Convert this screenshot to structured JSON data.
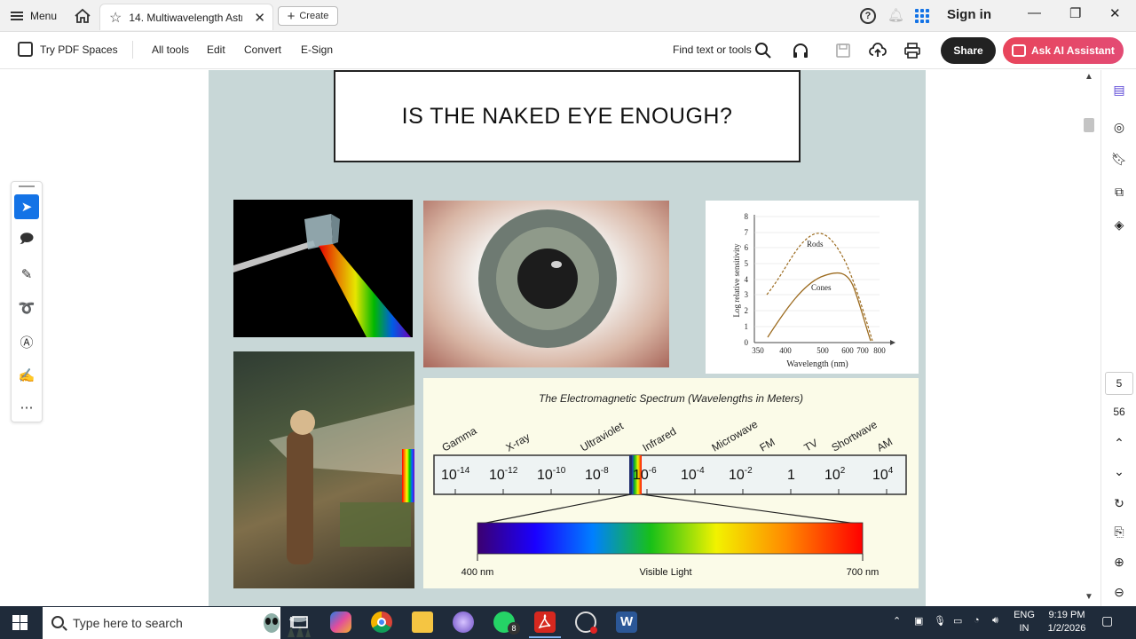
{
  "titlebar": {
    "menu_label": "Menu",
    "tab_title": "14. Multiwavelength Astr...",
    "create_label": "Create",
    "sign_in": "Sign in"
  },
  "toolbar": {
    "spaces_label": "Try PDF Spaces",
    "menu_items": [
      "All tools",
      "Edit",
      "Convert",
      "E-Sign"
    ],
    "find_label": "Find text or tools",
    "share_label": "Share",
    "ai_label": "Ask AI Assistant"
  },
  "slide": {
    "title": "IS THE NAKED EYE ENOUGH?",
    "sensitivity": {
      "ylabel": "Log relative sensitivity",
      "xlabel": "Wavelength (nm)",
      "yticks": [
        "0",
        "1",
        "2",
        "3",
        "4",
        "5",
        "6",
        "7",
        "8"
      ],
      "xticks": [
        "350",
        "400",
        "500",
        "600",
        "700",
        "800"
      ],
      "rods_label": "Rods",
      "cones_label": "Cones"
    },
    "em": {
      "title": "The Electromagnetic Spectrum (Wavelengths in Meters)",
      "bands": [
        "Gamma",
        "X-ray",
        "Ultraviolet",
        "Infrared",
        "Microwave",
        "FM",
        "TV",
        "Shortwave",
        "AM"
      ],
      "ticks": [
        {
          "base": "10",
          "exp": "-14"
        },
        {
          "base": "10",
          "exp": "-12"
        },
        {
          "base": "10",
          "exp": "-10"
        },
        {
          "base": "10",
          "exp": "-8"
        },
        {
          "base": "10",
          "exp": "-6"
        },
        {
          "base": "10",
          "exp": "-4"
        },
        {
          "base": "10",
          "exp": "-2"
        },
        {
          "base": "1",
          "exp": ""
        },
        {
          "base": "10",
          "exp": "2"
        },
        {
          "base": "10",
          "exp": "4"
        }
      ],
      "visible_start": "400 nm",
      "visible_label": "Visible Light",
      "visible_end": "700 nm"
    }
  },
  "sidebar": {
    "current_page": "5",
    "total_pages": "56"
  },
  "taskbar": {
    "search_placeholder": "Type here to search",
    "whatsapp_badge": "8",
    "lang_top": "ENG",
    "lang_bottom": "IN",
    "time": "9:19 PM",
    "date": "1/2/2026"
  }
}
